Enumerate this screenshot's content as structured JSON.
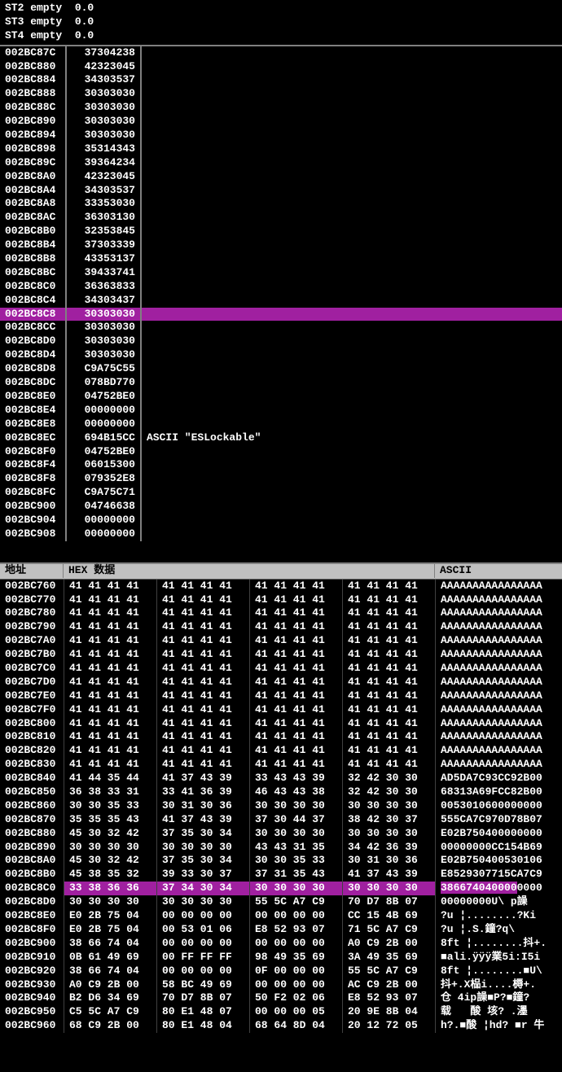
{
  "registers": [
    "ST2 empty  0.0",
    "ST3 empty  0.0",
    "ST4 empty  0.0"
  ],
  "disassembly": {
    "highlight_addr": "002BC8C8",
    "rows": [
      {
        "addr": "002BC87C",
        "bytes": "37304238",
        "comment": ""
      },
      {
        "addr": "002BC880",
        "bytes": "42323045",
        "comment": ""
      },
      {
        "addr": "002BC884",
        "bytes": "34303537",
        "comment": ""
      },
      {
        "addr": "002BC888",
        "bytes": "30303030",
        "comment": ""
      },
      {
        "addr": "002BC88C",
        "bytes": "30303030",
        "comment": ""
      },
      {
        "addr": "002BC890",
        "bytes": "30303030",
        "comment": ""
      },
      {
        "addr": "002BC894",
        "bytes": "30303030",
        "comment": ""
      },
      {
        "addr": "002BC898",
        "bytes": "35314343",
        "comment": ""
      },
      {
        "addr": "002BC89C",
        "bytes": "39364234",
        "comment": ""
      },
      {
        "addr": "002BC8A0",
        "bytes": "42323045",
        "comment": ""
      },
      {
        "addr": "002BC8A4",
        "bytes": "34303537",
        "comment": ""
      },
      {
        "addr": "002BC8A8",
        "bytes": "33353030",
        "comment": ""
      },
      {
        "addr": "002BC8AC",
        "bytes": "36303130",
        "comment": ""
      },
      {
        "addr": "002BC8B0",
        "bytes": "32353845",
        "comment": ""
      },
      {
        "addr": "002BC8B4",
        "bytes": "37303339",
        "comment": ""
      },
      {
        "addr": "002BC8B8",
        "bytes": "43353137",
        "comment": ""
      },
      {
        "addr": "002BC8BC",
        "bytes": "39433741",
        "comment": ""
      },
      {
        "addr": "002BC8C0",
        "bytes": "36363833",
        "comment": ""
      },
      {
        "addr": "002BC8C4",
        "bytes": "34303437",
        "comment": ""
      },
      {
        "addr": "002BC8C8",
        "bytes": "30303030",
        "comment": ""
      },
      {
        "addr": "002BC8CC",
        "bytes": "30303030",
        "comment": ""
      },
      {
        "addr": "002BC8D0",
        "bytes": "30303030",
        "comment": ""
      },
      {
        "addr": "002BC8D4",
        "bytes": "30303030",
        "comment": ""
      },
      {
        "addr": "002BC8D8",
        "bytes": "C9A75C55",
        "comment": ""
      },
      {
        "addr": "002BC8DC",
        "bytes": "078BD770",
        "comment": ""
      },
      {
        "addr": "002BC8E0",
        "bytes": "04752BE0",
        "comment": ""
      },
      {
        "addr": "002BC8E4",
        "bytes": "00000000",
        "comment": ""
      },
      {
        "addr": "002BC8E8",
        "bytes": "00000000",
        "comment": ""
      },
      {
        "addr": "002BC8EC",
        "bytes": "694B15CC",
        "comment": "ASCII \"ESLockable\""
      },
      {
        "addr": "002BC8F0",
        "bytes": "04752BE0",
        "comment": ""
      },
      {
        "addr": "002BC8F4",
        "bytes": "06015300",
        "comment": ""
      },
      {
        "addr": "002BC8F8",
        "bytes": "079352E8",
        "comment": ""
      },
      {
        "addr": "002BC8FC",
        "bytes": "C9A75C71",
        "comment": ""
      },
      {
        "addr": "002BC900",
        "bytes": "04746638",
        "comment": ""
      },
      {
        "addr": "002BC904",
        "bytes": "00000000",
        "comment": ""
      },
      {
        "addr": "002BC908",
        "bytes": "00000000",
        "comment": ""
      }
    ]
  },
  "hex_header": {
    "addr_label": "地址",
    "hex_label": "HEX 数据",
    "ascii_label": "ASCII"
  },
  "hex_dump": {
    "highlight_addr": "002BC8C0",
    "rows": [
      {
        "addr": "002BC760",
        "b": [
          "41 41 41 41",
          "41 41 41 41",
          "41 41 41 41",
          "41 41 41 41"
        ],
        "a": "AAAAAAAAAAAAAAAA"
      },
      {
        "addr": "002BC770",
        "b": [
          "41 41 41 41",
          "41 41 41 41",
          "41 41 41 41",
          "41 41 41 41"
        ],
        "a": "AAAAAAAAAAAAAAAA"
      },
      {
        "addr": "002BC780",
        "b": [
          "41 41 41 41",
          "41 41 41 41",
          "41 41 41 41",
          "41 41 41 41"
        ],
        "a": "AAAAAAAAAAAAAAAA"
      },
      {
        "addr": "002BC790",
        "b": [
          "41 41 41 41",
          "41 41 41 41",
          "41 41 41 41",
          "41 41 41 41"
        ],
        "a": "AAAAAAAAAAAAAAAA"
      },
      {
        "addr": "002BC7A0",
        "b": [
          "41 41 41 41",
          "41 41 41 41",
          "41 41 41 41",
          "41 41 41 41"
        ],
        "a": "AAAAAAAAAAAAAAAA"
      },
      {
        "addr": "002BC7B0",
        "b": [
          "41 41 41 41",
          "41 41 41 41",
          "41 41 41 41",
          "41 41 41 41"
        ],
        "a": "AAAAAAAAAAAAAAAA"
      },
      {
        "addr": "002BC7C0",
        "b": [
          "41 41 41 41",
          "41 41 41 41",
          "41 41 41 41",
          "41 41 41 41"
        ],
        "a": "AAAAAAAAAAAAAAAA"
      },
      {
        "addr": "002BC7D0",
        "b": [
          "41 41 41 41",
          "41 41 41 41",
          "41 41 41 41",
          "41 41 41 41"
        ],
        "a": "AAAAAAAAAAAAAAAA"
      },
      {
        "addr": "002BC7E0",
        "b": [
          "41 41 41 41",
          "41 41 41 41",
          "41 41 41 41",
          "41 41 41 41"
        ],
        "a": "AAAAAAAAAAAAAAAA"
      },
      {
        "addr": "002BC7F0",
        "b": [
          "41 41 41 41",
          "41 41 41 41",
          "41 41 41 41",
          "41 41 41 41"
        ],
        "a": "AAAAAAAAAAAAAAAA"
      },
      {
        "addr": "002BC800",
        "b": [
          "41 41 41 41",
          "41 41 41 41",
          "41 41 41 41",
          "41 41 41 41"
        ],
        "a": "AAAAAAAAAAAAAAAA"
      },
      {
        "addr": "002BC810",
        "b": [
          "41 41 41 41",
          "41 41 41 41",
          "41 41 41 41",
          "41 41 41 41"
        ],
        "a": "AAAAAAAAAAAAAAAA"
      },
      {
        "addr": "002BC820",
        "b": [
          "41 41 41 41",
          "41 41 41 41",
          "41 41 41 41",
          "41 41 41 41"
        ],
        "a": "AAAAAAAAAAAAAAAA"
      },
      {
        "addr": "002BC830",
        "b": [
          "41 41 41 41",
          "41 41 41 41",
          "41 41 41 41",
          "41 41 41 41"
        ],
        "a": "AAAAAAAAAAAAAAAA"
      },
      {
        "addr": "002BC840",
        "b": [
          "41 44 35 44",
          "41 37 43 39",
          "33 43 43 39",
          "32 42 30 30"
        ],
        "a": "AD5DA7C93CC92B00"
      },
      {
        "addr": "002BC850",
        "b": [
          "36 38 33 31",
          "33 41 36 39",
          "46 43 43 38",
          "32 42 30 30"
        ],
        "a": "68313A69FCC82B00"
      },
      {
        "addr": "002BC860",
        "b": [
          "30 30 35 33",
          "30 31 30 36",
          "30 30 30 30",
          "30 30 30 30"
        ],
        "a": "0053010600000000"
      },
      {
        "addr": "002BC870",
        "b": [
          "35 35 35 43",
          "41 37 43 39",
          "37 30 44 37",
          "38 42 30 37"
        ],
        "a": "555CA7C970D78B07"
      },
      {
        "addr": "002BC880",
        "b": [
          "45 30 32 42",
          "37 35 30 34",
          "30 30 30 30",
          "30 30 30 30"
        ],
        "a": "E02B750400000000"
      },
      {
        "addr": "002BC890",
        "b": [
          "30 30 30 30",
          "30 30 30 30",
          "43 43 31 35",
          "34 42 36 39"
        ],
        "a": "00000000CC154B69"
      },
      {
        "addr": "002BC8A0",
        "b": [
          "45 30 32 42",
          "37 35 30 34",
          "30 30 35 33",
          "30 31 30 36"
        ],
        "a": "E02B750400530106"
      },
      {
        "addr": "002BC8B0",
        "b": [
          "45 38 35 32",
          "39 33 30 37",
          "37 31 35 43",
          "41 37 43 39"
        ],
        "a": "E8529307715CA7C9"
      },
      {
        "addr": "002BC8C0",
        "b": [
          "33 38 36 36",
          "37 34 30 34",
          "30 30 30 30",
          "30 30 30 30"
        ],
        "a": "3866740400000000"
      },
      {
        "addr": "002BC8D0",
        "b": [
          "30 30 30 30",
          "30 30 30 30",
          "55 5C A7 C9",
          "70 D7 8B 07"
        ],
        "a": "00000000U\\ p譟"
      },
      {
        "addr": "002BC8E0",
        "b": [
          "E0 2B 75 04",
          "00 00 00 00",
          "00 00 00 00",
          "CC 15 4B 69"
        ],
        "a": "?u ¦........?Ki"
      },
      {
        "addr": "002BC8F0",
        "b": [
          "E0 2B 75 04",
          "00 53 01 06",
          "E8 52 93 07",
          "71 5C A7 C9"
        ],
        "a": "?u ¦.S.鐘?q\\"
      },
      {
        "addr": "002BC900",
        "b": [
          "38 66 74 04",
          "00 00 00 00",
          "00 00 00 00",
          "A0 C9 2B 00"
        ],
        "a": "8ft ¦........抖+."
      },
      {
        "addr": "002BC910",
        "b": [
          "0B 61 49 69",
          "00 FF FF FF",
          "98 49 35 69",
          "3A 49 35 69"
        ],
        "a": "■ali.ÿÿÿ業5i:I5i"
      },
      {
        "addr": "002BC920",
        "b": [
          "38 66 74 04",
          "00 00 00 00",
          "0F 00 00 00",
          "55 5C A7 C9"
        ],
        "a": "8ft ¦........■U\\"
      },
      {
        "addr": "002BC930",
        "b": [
          "A0 C9 2B 00",
          "58 BC 49 69",
          "00 00 00 00",
          "AC C9 2B 00"
        ],
        "a": "抖+.X榀i....槈+."
      },
      {
        "addr": "002BC940",
        "b": [
          "B2 D6 34 69",
          "70 D7 8B 07",
          "50 F2 02 06",
          "E8 52 93 07"
        ],
        "a": "仓 4ip譟■P?■鐘?"
      },
      {
        "addr": "002BC950",
        "b": [
          "C5 5C A7 C9",
          "80 E1 48 07",
          "00 00 00 05",
          "20 9E 8B 04"
        ],
        "a": "载   酸 垓? .濹 "
      },
      {
        "addr": "002BC960",
        "b": [
          "68 C9 2B 00",
          "80 E1 48 04",
          "68 64 8D 04",
          "20 12 72 05"
        ],
        "a": "h?.■酸 ¦hd? ■r 牛"
      }
    ]
  }
}
